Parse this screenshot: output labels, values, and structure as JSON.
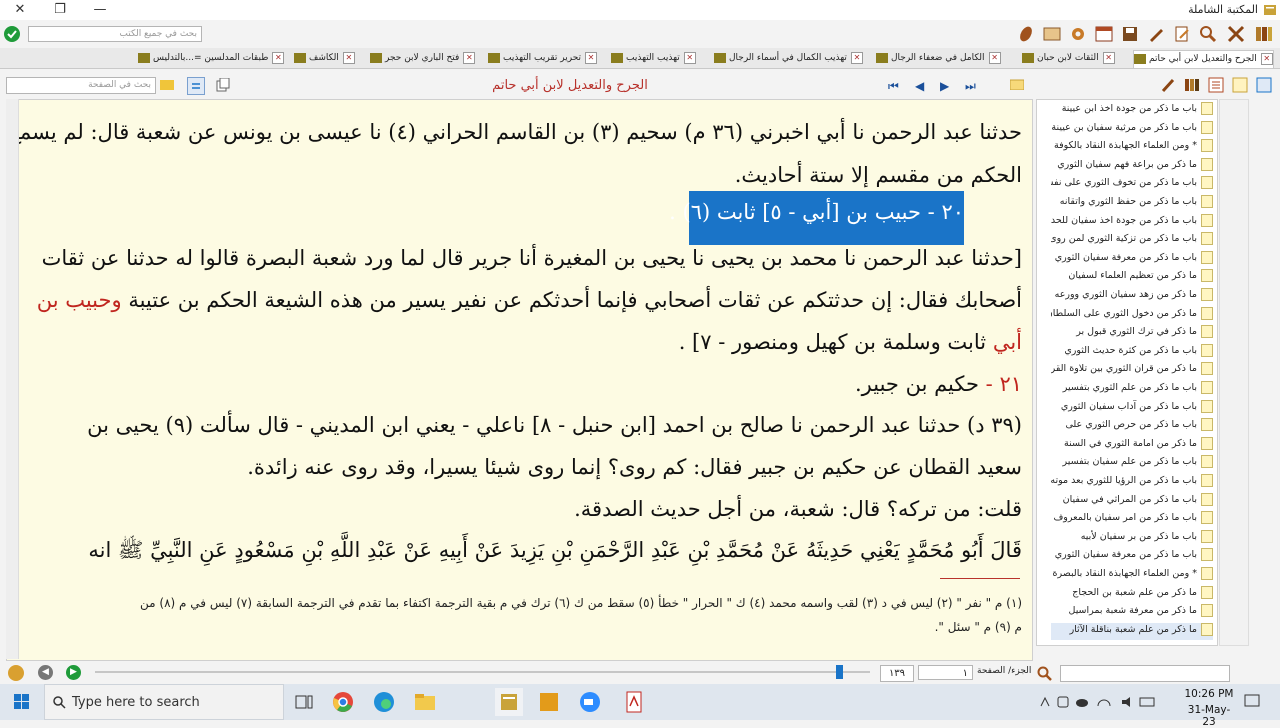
{
  "app_title": "المكتبة الشاملة",
  "global_search_placeholder": "بحث في جميع الكتب",
  "tabs": [
    {
      "label": "الجرح والتعديل لابن أبي حاتم",
      "active": true
    },
    {
      "label": "الثقات لابن حبان"
    },
    {
      "label": "الكامل في ضعفاء الرجال"
    },
    {
      "label": "تهذيب الكمال في أسماء الرجال"
    },
    {
      "label": "تهذيب التهذيب"
    },
    {
      "label": "تحرير تقريب التهذيب"
    },
    {
      "label": "فتح الباري لابن حجر"
    },
    {
      "label": "الكاشف"
    },
    {
      "label": "طبقات المدلسين =...بالتدليس"
    }
  ],
  "page_search_placeholder": "بحث في الصفحة",
  "book_title": "الجرح والتعديل لابن أبي حاتم",
  "content": {
    "l1": "حدثنا عبد الرحمن نا أبي اخبرني (٣٦ م) سحيم (٣) بن القاسم الحراني (٤) نا عيسى بن يونس عن شعبة قال: لم يسمع",
    "l2": "الحكم من مقسم إلا ستة أحاديث.",
    "l3_highlight": "٢٠ - حبيب بن [أبي - ٥] ثابت (٦) .",
    "l4": "[حدثنا عبد الرحمن نا محمد بن يحيى نا يحيى بن المغيرة أنا جرير قال لما ورد شعبة البصرة قالوا له حدثنا عن ثقات",
    "l5a": "أصحابك فقال: إن حدثتكم عن ثقات أصحابي فإنما أحدثكم عن نفير يسير من هذه الشيعة الحكم بن عتيبة ",
    "l5b": "وحبيب بن",
    "l6a": "أبي",
    "l6b": " ثابت وسلمة بن كهيل ومنصور - ٧] .",
    "l7a": "٢١ - ",
    "l7b": "حكيم بن جبير.",
    "l8": "(٣٩ د) حدثنا عبد الرحمن نا صالح بن احمد [ابن حنبل - ٨] ناعلي - يعني ابن المديني - قال سألت (٩) يحيى بن",
    "l9": "سعيد القطان عن حكيم بن جبير فقال: كم روى؟ إنما روى شيئا يسيرا، وقد روى عنه زائدة.",
    "l10": "قلت: من تركه؟ قال: شعبة، من أجل حديث الصدقة.",
    "l11": "قَالَ أَبُو مُحَمَّدٍ يَعْنِي حَدِيثَهُ عَنْ مُحَمَّدِ بْنِ عَبْدِ الرَّحْمَنِ بْنِ يَزِيدَ عَنْ أَبِيهِ عَنْ عَبْدِ اللَّهِ بْنِ مَسْعُودٍ عَنِ النَّبِيِّ ﷺ انه",
    "fn1": "(١) م \" نفر \" (٢) ليس في د (٣) لقب واسمه محمد (٤) ك \" الحرار \" خطأ (٥) سقط من ك (٦) ترك في م بقية الترجمة اكتفاء بما تقدم في الترجمة السابقة (٧) ليس في م (٨) من",
    "fn2": "م (٩) م \" سئل \"."
  },
  "toc": [
    "باب ما ذكر من جودة اخذ ابن عيينة",
    "باب ما ذكر من مرثية سفيان بن عيينة",
    "* ومن العلماء الجهابذة النقاد بالكوفة",
    "ما ذكر من براعة فهم سفيان الثوري",
    "باب ما ذكر من تخوف الثوري على نفسه",
    "باب ما ذكر من حفظ الثوري واتقانه",
    "باب ما ذكر من جودة اخذ سفيان للحديث",
    "باب ما ذكر من تزكية الثوري لمن روى عنه",
    "باب ما ذكر من معرفة سفيان الثوري",
    "ما ذكر من تعظيم العلماء لسفيان",
    "ما ذكر من زهد سفيان الثوري وورعه",
    "ما ذكر من دخول الثوري على السلطان",
    "ما ذكر في ترك الثوري قبول بر",
    "باب ما ذكر من كثرة حديث الثوري",
    "ما ذكر من قران الثوري بين تلاوة القرآن",
    "باب ما ذكر من علم الثوري بتفسير",
    "باب ما ذكر من آداب سفيان الثوري",
    "باب ما ذكر من حرص الثوري على",
    "ما ذكر من امامة الثوري في السنة",
    "باب ما ذكر من علم سفيان بتفسير",
    "باب ما ذكر من الرؤيا للثوري بعد موته",
    "باب ما ذكر من المراثي في سفيان",
    "باب ما ذكر من امر سفيان بالمعروف",
    "باب ما ذكر من بر سفيان لأبيه",
    "باب ما ذكر من معرفة سفيان الثوري",
    "* ومن العلماء الجهابذة النقاد بالبصرة",
    "ما ذكر من علم شعبة بن الحجاج",
    "ما ذكر من معرفة شعبة بمراسيل",
    "ما ذكر من علم شعبة بناقلة الآثار"
  ],
  "bottom": {
    "page": "١٣٩",
    "part": "١",
    "part_page_label": "الجزء/ الصفحة"
  },
  "taskbar": {
    "search_placeholder": "Type here to search",
    "time": "10:26 PM",
    "date": "31-May-23"
  },
  "colors": {
    "accent": "#1a74c8",
    "highlight_red": "#c0261f",
    "page_bg": "#fdfbe3"
  }
}
